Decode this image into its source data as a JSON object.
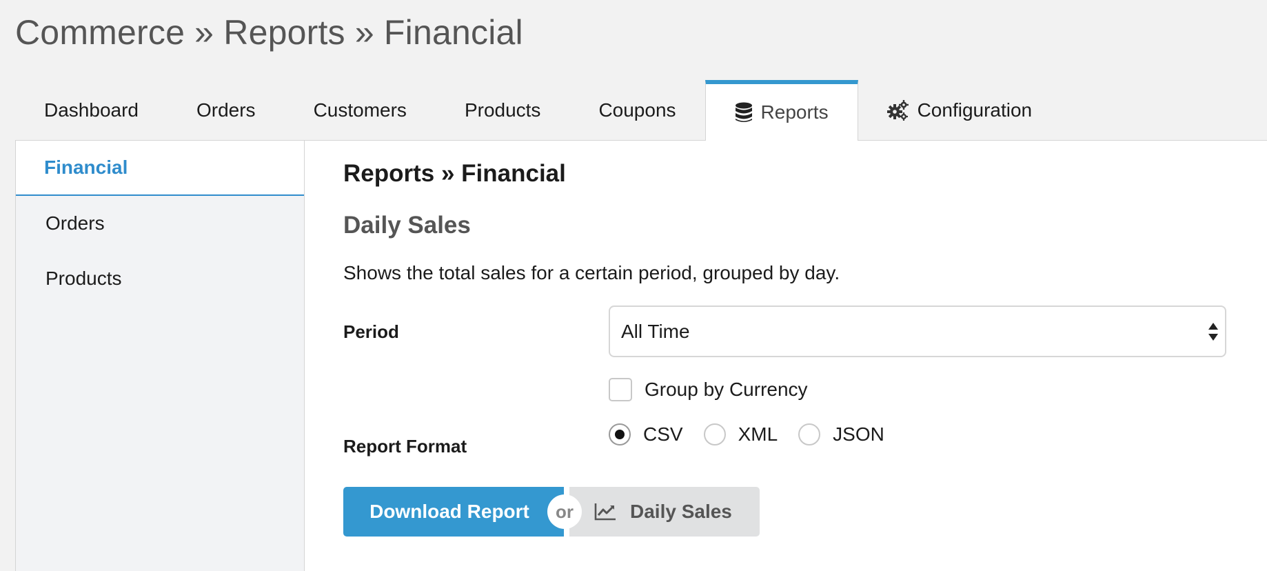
{
  "page": {
    "title": "Commerce » Reports » Financial"
  },
  "tabs": [
    {
      "label": "Dashboard",
      "active": false
    },
    {
      "label": "Orders",
      "active": false
    },
    {
      "label": "Customers",
      "active": false
    },
    {
      "label": "Products",
      "active": false
    },
    {
      "label": "Coupons",
      "active": false
    },
    {
      "label": "Reports",
      "active": true,
      "icon": "database-icon"
    },
    {
      "label": "Configuration",
      "active": false,
      "icon": "gears-icon"
    }
  ],
  "sidebar": {
    "items": [
      {
        "label": "Financial",
        "active": true
      },
      {
        "label": "Orders",
        "active": false
      },
      {
        "label": "Products",
        "active": false
      }
    ]
  },
  "main": {
    "breadcrumb": "Reports » Financial",
    "section_title": "Daily Sales",
    "description": "Shows the total sales for a certain period, grouped by day.",
    "period_label": "Period",
    "period_value": "All Time",
    "group_by_currency_label": "Group by Currency",
    "group_by_currency_checked": false,
    "format_label": "Report Format",
    "formats": [
      {
        "label": "CSV",
        "checked": true
      },
      {
        "label": "XML",
        "checked": false
      },
      {
        "label": "JSON",
        "checked": false
      }
    ],
    "download_button": "Download Report",
    "or_text": "or",
    "daily_sales_button": "Daily Sales"
  },
  "colors": {
    "accent": "#3498d0",
    "active_sidebar": "#2f8ccc",
    "page_background": "#f2f2f2"
  }
}
